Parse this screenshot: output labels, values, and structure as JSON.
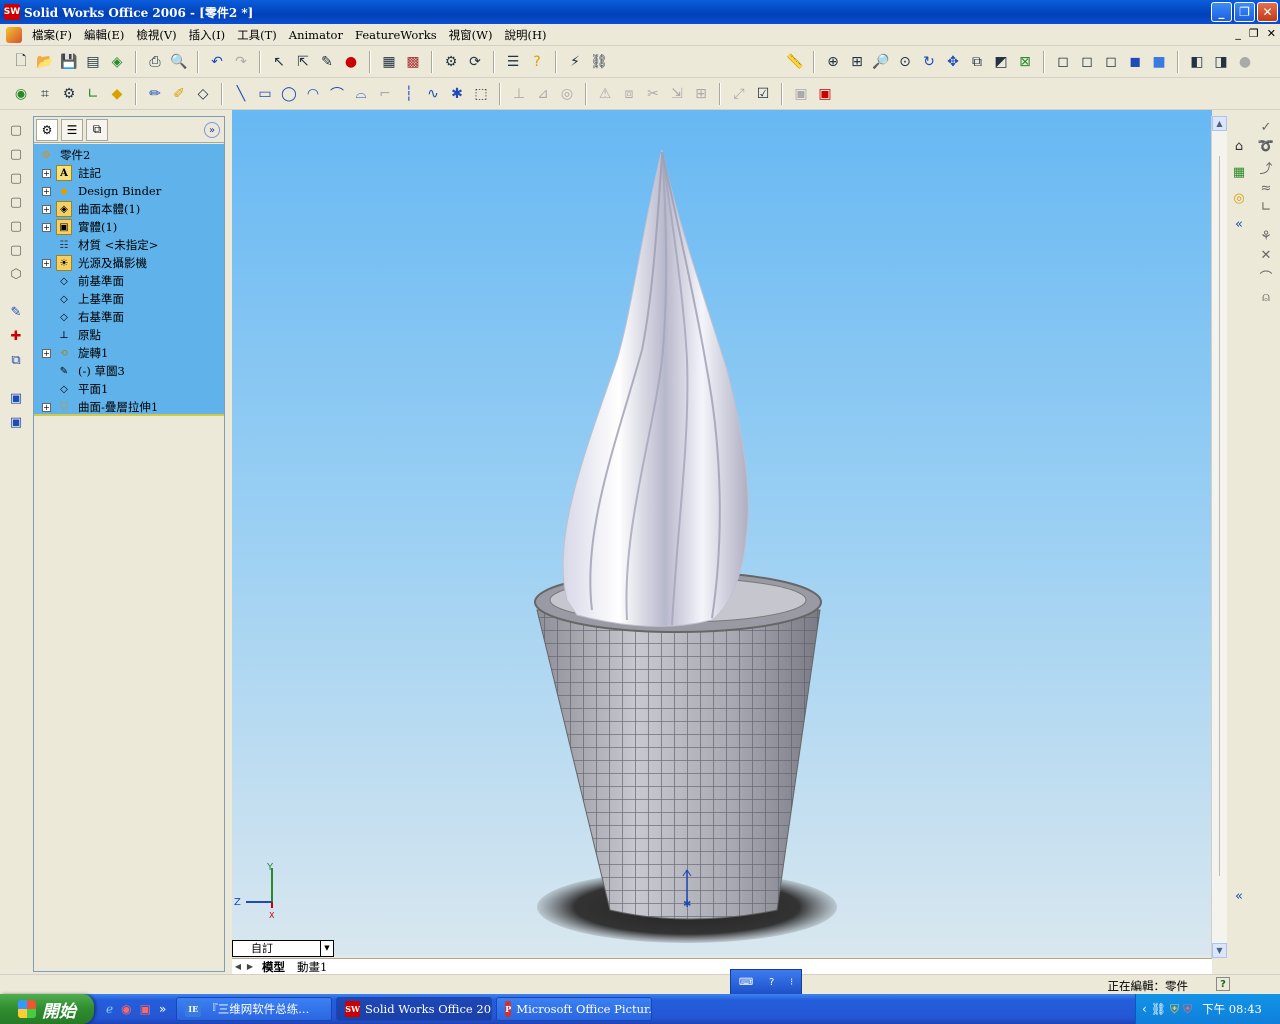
{
  "window": {
    "title": "Solid Works Office 2006 - [零件2 *]",
    "app_icon_text": "SW"
  },
  "menu": {
    "items": [
      "檔案(F)",
      "編輯(E)",
      "檢視(V)",
      "插入(I)",
      "工具(T)",
      "Animator",
      "FeatureWorks",
      "視窗(W)",
      "說明(H)"
    ]
  },
  "feature_tree": {
    "root": "零件2",
    "nodes": [
      {
        "label": "註記",
        "icon": "annotation-icon",
        "expand": true
      },
      {
        "label": "Design Binder",
        "icon": "design-binder-icon",
        "expand": true
      },
      {
        "label": "曲面本體(1)",
        "icon": "surface-bodies-icon",
        "expand": true
      },
      {
        "label": "實體(1)",
        "icon": "solid-bodies-icon",
        "expand": true
      },
      {
        "label": "材質 <未指定>",
        "icon": "material-icon",
        "expand": false
      },
      {
        "label": "光源及攝影機",
        "icon": "lights-cameras-icon",
        "expand": true
      },
      {
        "label": "前基準面",
        "icon": "plane-icon",
        "expand": false
      },
      {
        "label": "上基準面",
        "icon": "plane-icon",
        "expand": false
      },
      {
        "label": "右基準面",
        "icon": "plane-icon",
        "expand": false
      },
      {
        "label": "原點",
        "icon": "origin-icon",
        "expand": false
      },
      {
        "label": "旋轉1",
        "icon": "revolve-icon",
        "expand": true
      },
      {
        "label": "(-) 草圖3",
        "icon": "sketch-icon",
        "expand": false
      },
      {
        "label": "平面1",
        "icon": "plane-icon",
        "expand": false
      },
      {
        "label": "曲面-疊層拉伸1",
        "icon": "loft-surface-icon",
        "expand": true
      }
    ]
  },
  "viewport": {
    "view_orientation": "自訂",
    "triad": {
      "x": "X",
      "y": "Y",
      "z": "Z"
    }
  },
  "tabs": {
    "items": [
      "模型",
      "動畫1"
    ],
    "active": 0
  },
  "status": {
    "text": "正在編輯：零件",
    "help": "?"
  },
  "taskbar": {
    "start_label": "開始",
    "quick_more": "»",
    "buttons": [
      {
        "label": "『三维网软件总练...",
        "icon_text": "IE",
        "active": false
      },
      {
        "label": "Solid Works Office 20...",
        "icon_text": "SW",
        "active": true
      },
      {
        "label": "Microsoft Office Pictur...",
        "icon_text": "P",
        "active": false
      }
    ],
    "clock": "下午 08:43"
  },
  "colors": {
    "viewport_top": "#67b8f3",
    "viewport_bottom": "#d9e7ef",
    "tree_bg": "#5fb2ea",
    "titlebar": "#0140b8"
  }
}
